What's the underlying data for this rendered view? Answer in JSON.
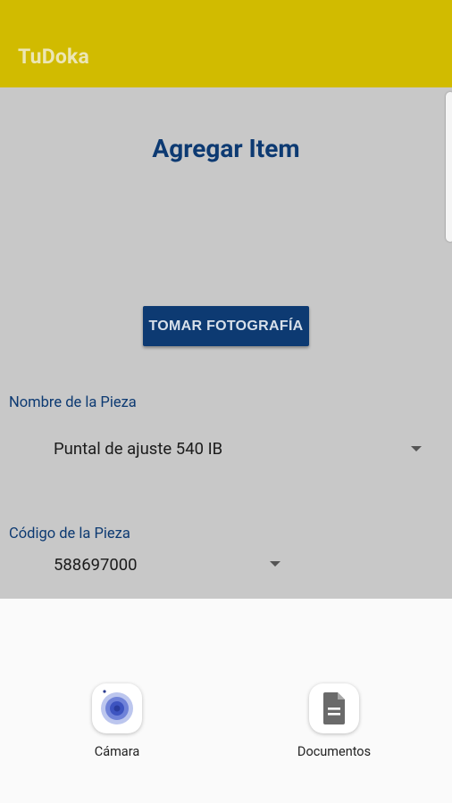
{
  "app": {
    "title": "TuDoka",
    "accent_color": "#d1bb00",
    "primary_color": "#0d3a72"
  },
  "page": {
    "title": "Agregar Item"
  },
  "photo_button": {
    "label": "TOMAR FOTOGRAFÍA"
  },
  "fields": {
    "part_name": {
      "label": "Nombre de la Pieza",
      "value": "Puntal de ajuste 540 IB"
    },
    "part_code": {
      "label": "Código de la Pieza",
      "value": "588697000"
    }
  },
  "share_sheet": {
    "items": [
      {
        "label": "Cámara",
        "icon": "camera-icon"
      },
      {
        "label": "Documentos",
        "icon": "document-icon"
      }
    ]
  }
}
